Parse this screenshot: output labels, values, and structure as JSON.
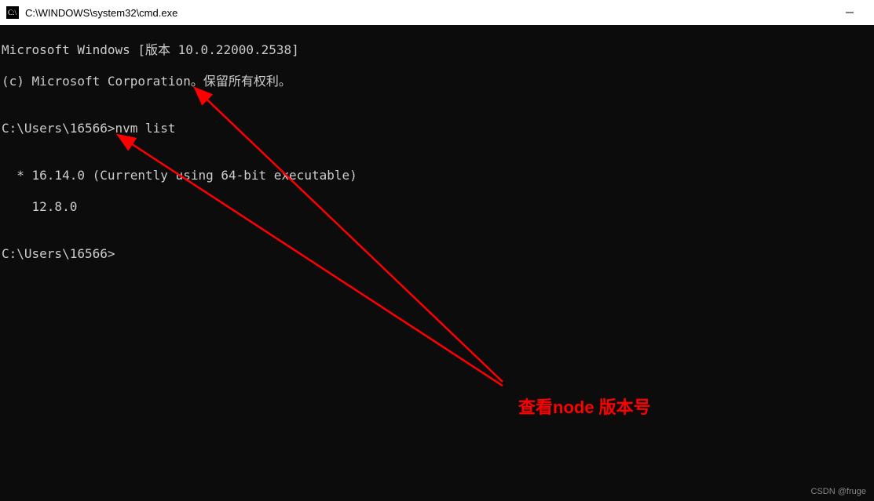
{
  "titlebar": {
    "title": "C:\\WINDOWS\\system32\\cmd.exe"
  },
  "terminal": {
    "header_line1": "Microsoft Windows [版本 10.0.22000.2538]",
    "header_line2": "(c) Microsoft Corporation。保留所有权利。",
    "blank": "",
    "prompt1_path": "C:\\Users\\16566>",
    "prompt1_cmd": "nvm list",
    "list_line1": "  * 16.14.0 (Currently using 64-bit executable)",
    "list_line2": "    12.8.0",
    "prompt2_path": "C:\\Users\\16566>"
  },
  "annotation": {
    "label": "查看node 版本号"
  },
  "watermark": {
    "text": "CSDN @fruge"
  }
}
